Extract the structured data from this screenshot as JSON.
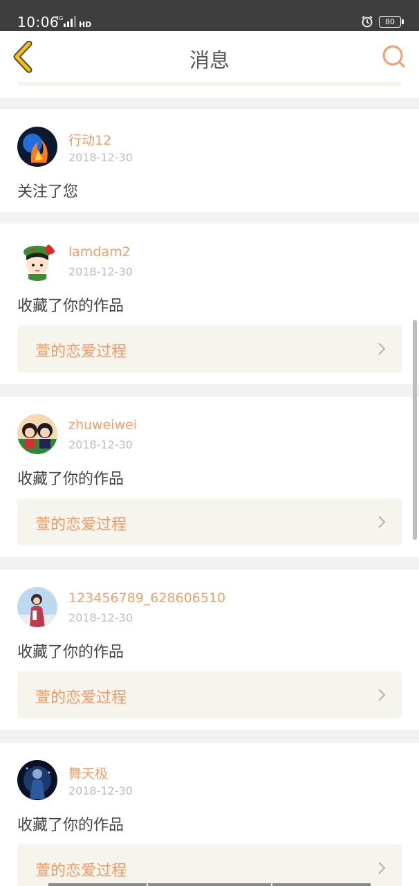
{
  "status": {
    "time": "10:06",
    "network": "4G",
    "hd": "HD",
    "battery": "80"
  },
  "header": {
    "title": "消息"
  },
  "messages": [
    {
      "username": "行动12",
      "date": "2018-12-30",
      "action": "关注了您"
    },
    {
      "username": "lamdam2",
      "date": "2018-12-30",
      "action": "收藏了你的作品",
      "work_title": "萱的恋爱过程"
    },
    {
      "username": "zhuweiwei",
      "date": "2018-12-30",
      "action": "收藏了你的作品",
      "work_title": "萱的恋爱过程"
    },
    {
      "username": "123456789_628606510",
      "date": "2018-12-30",
      "action": "收藏了你的作品",
      "work_title": "萱的恋爱过程"
    },
    {
      "username": "舞天极",
      "date": "2018-12-30",
      "action": "收藏了你的作品",
      "work_title": "萱的恋爱过程"
    }
  ],
  "colors": {
    "accent": "#f0a06a",
    "back_icon": "#f0c11a",
    "link_bg": "#f5f5ee"
  }
}
